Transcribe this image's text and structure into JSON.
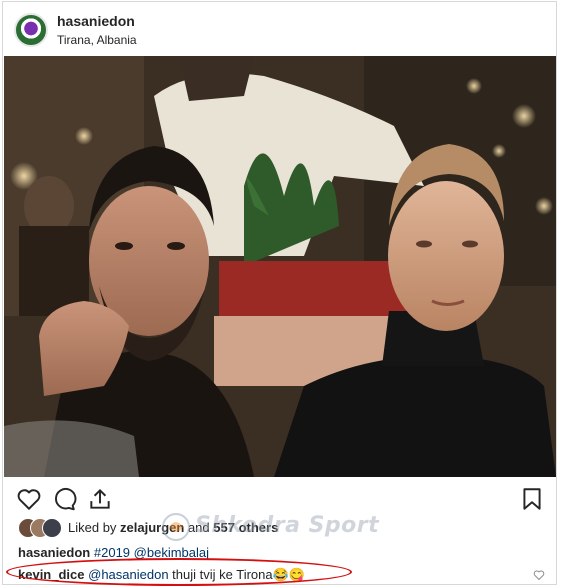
{
  "post": {
    "username": "hasaniedon",
    "location": "Tirana, Albania"
  },
  "actions": {
    "like_icon": "heart-icon",
    "comment_icon": "comment-icon",
    "share_icon": "share-icon",
    "save_icon": "bookmark-icon"
  },
  "likes": {
    "prefix": "Liked by ",
    "first_liker": "zelajurgen",
    "middle": " and ",
    "others": "557 others"
  },
  "caption": {
    "username": "hasaniedon",
    "hashtag": "#2019",
    "mention": "@bekimbalaj"
  },
  "comment": {
    "username": "kevin_dice",
    "mention": "@hasaniedon",
    "text": " thuji tvij ke Tirona😂😋"
  },
  "watermark": {
    "text": "Shkodra Sport"
  },
  "colors": {
    "highlight_ellipse": "#d40f0f",
    "link": "#003569"
  }
}
